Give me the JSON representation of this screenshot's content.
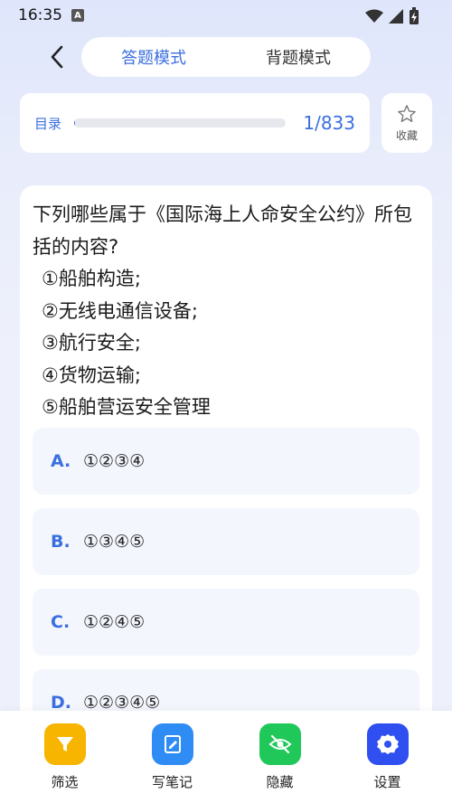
{
  "status_bar": {
    "time": "16:35",
    "badge": "A"
  },
  "header": {
    "tabs": [
      {
        "label": "答题模式",
        "active": true
      },
      {
        "label": "背题模式",
        "active": false
      }
    ]
  },
  "progress": {
    "catalog_label": "目录",
    "count": "1/833",
    "current": 1,
    "total": 833
  },
  "favorite": {
    "label": "收藏"
  },
  "question": {
    "text": "下列哪些属于《国际海上人命安全公约》所包括的内容?",
    "items": [
      "①船舶构造;",
      "②无线电通信设备;",
      "③航行安全;",
      "④货物运输;",
      "⑤船舶营运安全管理"
    ]
  },
  "options": [
    {
      "letter": "A.",
      "text": "①②③④"
    },
    {
      "letter": "B.",
      "text": "①③④⑤"
    },
    {
      "letter": "C.",
      "text": "①②④⑤"
    },
    {
      "letter": "D.",
      "text": "①②③④⑤"
    }
  ],
  "bottom_nav": [
    {
      "label": "筛选",
      "icon": "filter-icon",
      "color": "#f7b500"
    },
    {
      "label": "写笔记",
      "icon": "note-icon",
      "color": "#2f8cf5"
    },
    {
      "label": "隐藏",
      "icon": "eye-off-icon",
      "color": "#20c85a"
    },
    {
      "label": "设置",
      "icon": "gear-icon",
      "color": "#2f4ff0"
    }
  ],
  "colors": {
    "accent": "#3b6fe0"
  }
}
